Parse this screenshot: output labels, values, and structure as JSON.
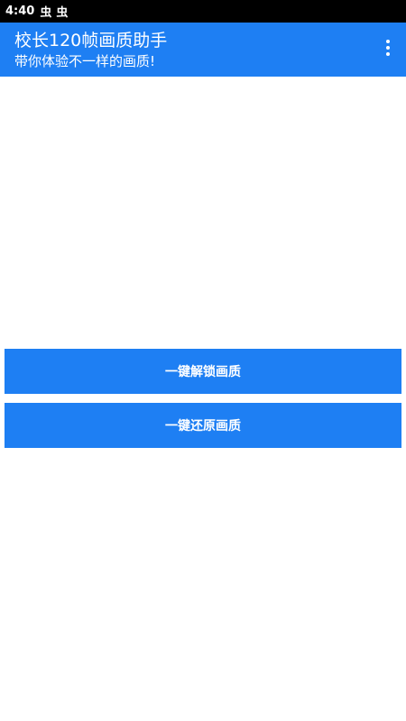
{
  "status_bar": {
    "time": "4:40",
    "icons": [
      {
        "name": "bug-icon",
        "glyph": "虫"
      },
      {
        "name": "bug-icon",
        "glyph": "虫"
      }
    ]
  },
  "app_bar": {
    "title": "校长120帧画质助手",
    "subtitle": "带你体验不一样的画质!",
    "menu_icon": "more-vert-icon",
    "color": "#1e7ff3"
  },
  "actions": {
    "unlock_label": "一键解锁画质",
    "restore_label": "一键还原画质"
  }
}
